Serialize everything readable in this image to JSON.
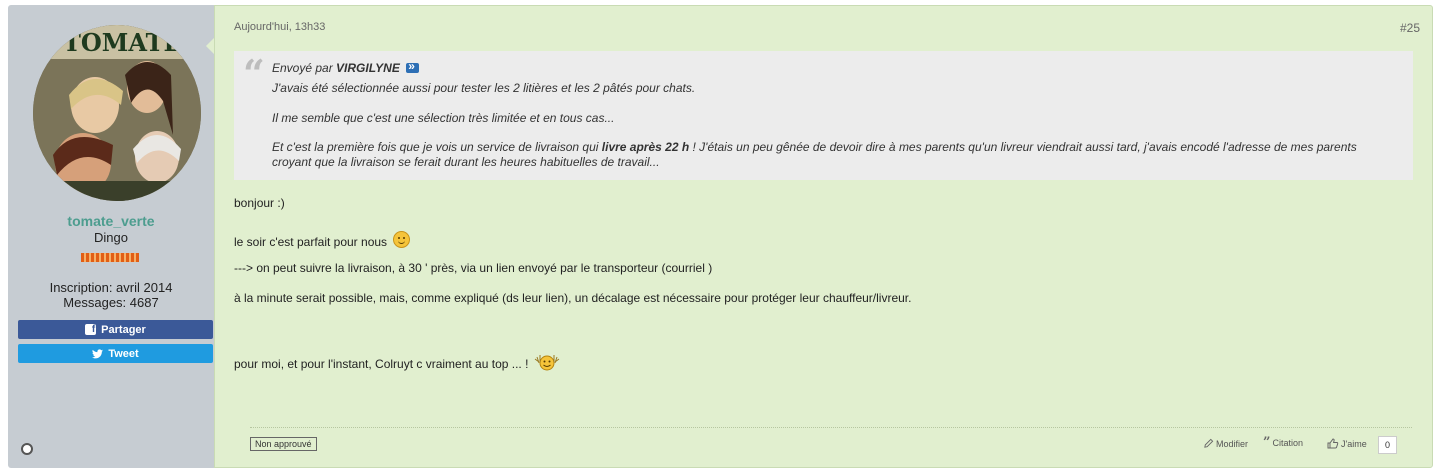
{
  "user": {
    "username": "tomate_verte",
    "title": "Dingo",
    "join_date": "Inscription: avril 2014",
    "messages": "Messages: 4687",
    "avatar_text": "TOMATE"
  },
  "share": {
    "facebook_label": "Partager",
    "twitter_label": "Tweet"
  },
  "post": {
    "date": "Aujourd'hui, 13h33",
    "number": "#25",
    "quote": {
      "prefix": "Envoyé par",
      "author": "VIRGILYNE",
      "line1": "J'avais été sélectionnée aussi pour tester les 2 litières et les 2 pâtés pour chats.",
      "line2": "Il me semble que c'est une sélection très limitée et en tous cas...",
      "line3_before": "Et c'est la première fois que je vois un service de livraison qui ",
      "line3_bold": "livre après 22 h",
      "line3_after": " ! J'étais un peu gênée de devoir dire à mes parents qu'un livreur viendrait aussi tard, j'avais encodé l'adresse de mes parents croyant que la livraison se ferait durant les heures habituelles de travail..."
    },
    "body": {
      "line1": "bonjour :)",
      "line2": "le soir c'est parfait pour nous",
      "line3": "---> on peut suivre la livraison, à 30 ' près, via un lien envoyé par le transporteur (courriel )",
      "line4": "à la minute serait possible, mais, comme expliqué (ds leur lien), un décalage est nécessaire pour protéger leur chauffeur/livreur.",
      "line5": "pour moi, et pour l'instant, Colruyt c vraiment au top ... !"
    }
  },
  "footer": {
    "status_badge": "Non approuvé",
    "edit_label": "Modifier",
    "quote_label": "Citation",
    "like_label": "J'aime",
    "like_count": "0"
  },
  "icons": {
    "facebook": "facebook-icon",
    "twitter": "twitter-icon",
    "edit": "pencil-icon",
    "quote": "quote-icon",
    "like": "thumbs-up-icon",
    "online": "online-status-icon"
  },
  "colors": {
    "content_bg": "#e1efcf",
    "sidebar_bg": "#c6ccd2",
    "username": "#4d9d8f",
    "facebook": "#3b5998",
    "twitter": "#1f9be0"
  }
}
